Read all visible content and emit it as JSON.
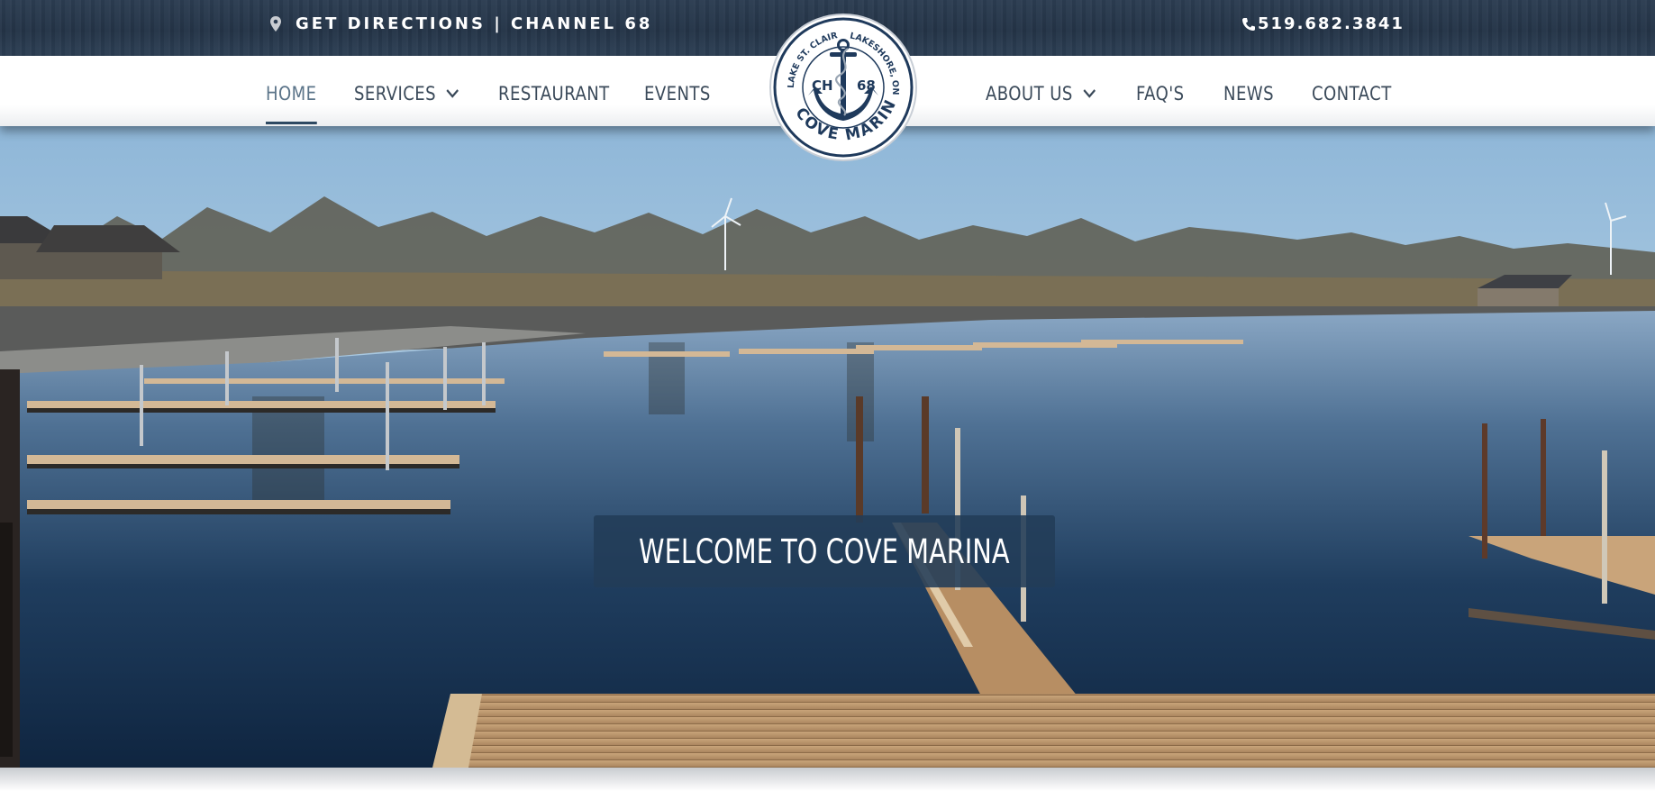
{
  "topbar": {
    "directions_text": "GET DIRECTIONS | CHANNEL 68",
    "phone": "519.682.3841"
  },
  "nav": {
    "left": [
      {
        "label": "HOME",
        "active": true
      },
      {
        "label": "SERVICES",
        "dropdown": true
      },
      {
        "label": "RESTAURANT"
      },
      {
        "label": "EVENTS"
      }
    ],
    "right": [
      {
        "label": "ABOUT US",
        "dropdown": true
      },
      {
        "label": "FAQ'S"
      },
      {
        "label": "NEWS"
      },
      {
        "label": "CONTACT"
      }
    ]
  },
  "logo": {
    "top_left_arc": "LAKE ST. CLAIR",
    "top_right_arc": "LAKESHORE, ON",
    "left_text": "CH",
    "right_text": "68",
    "bottom_arc": "COVE MARINA"
  },
  "hero": {
    "headline": "WELCOME TO COVE MARINA"
  },
  "colors": {
    "navy": "#1f3a5c",
    "topbar": "#263749",
    "nav_text": "#3b4a5a",
    "active_underline": "#2e4962",
    "banner": "#223c58"
  },
  "icons": [
    "map-pin-icon",
    "phone-icon",
    "chevron-down-icon",
    "anchor-icon"
  ]
}
